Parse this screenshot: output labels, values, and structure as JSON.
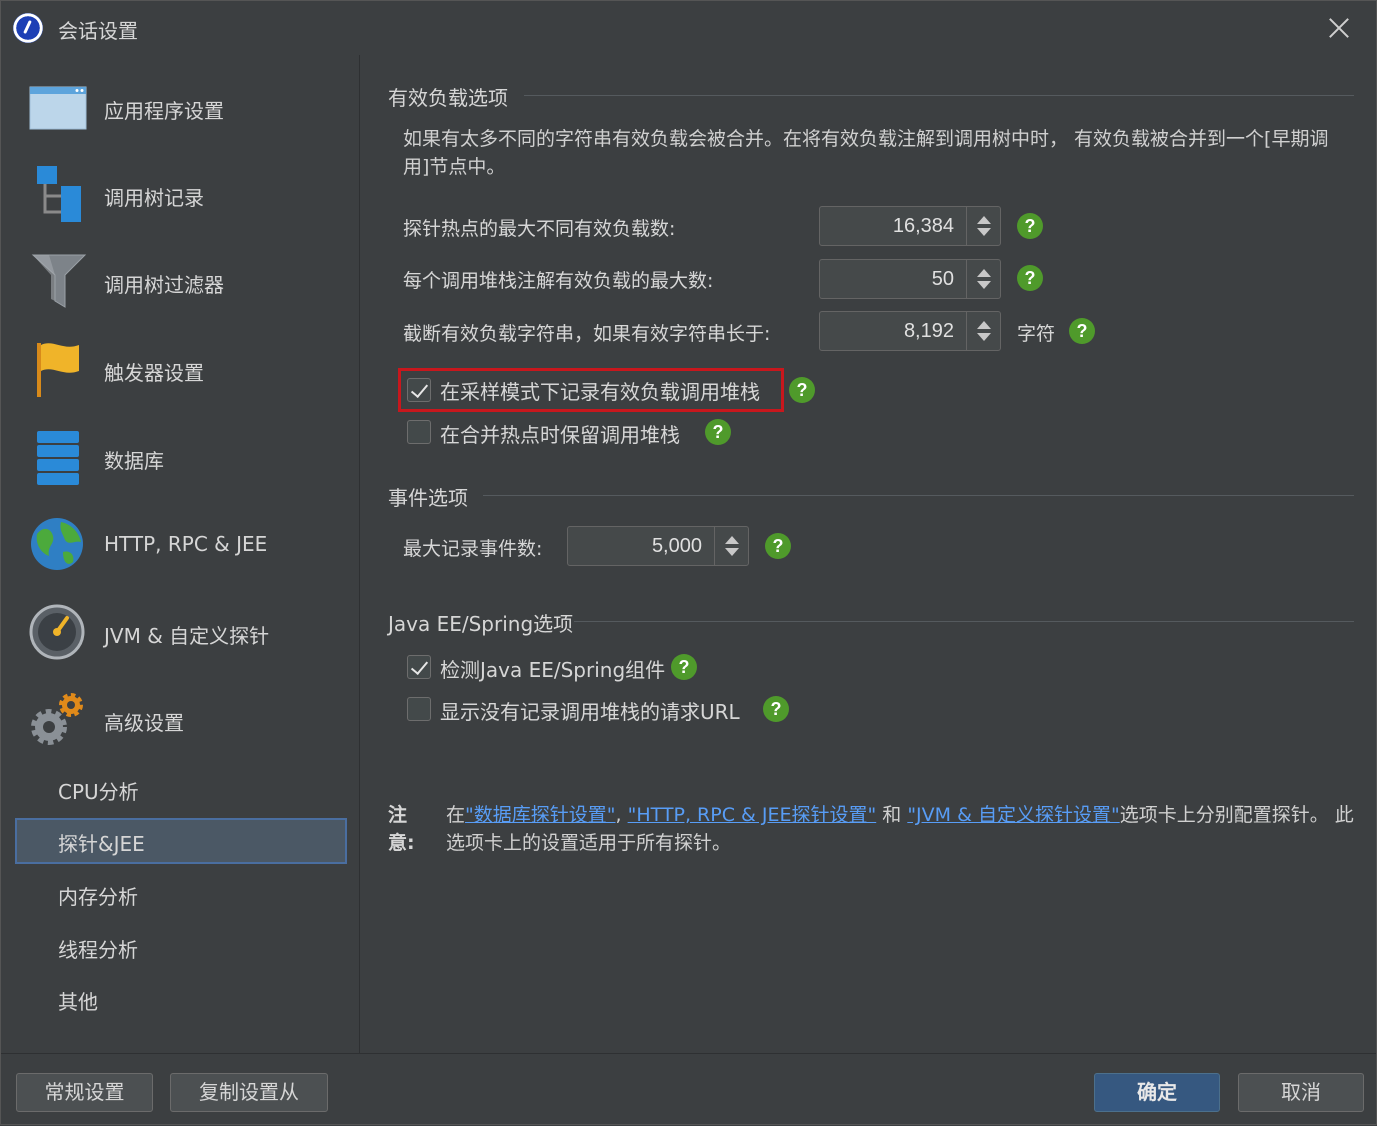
{
  "window": {
    "title": "会话设置"
  },
  "sidebar": {
    "items": [
      {
        "label": "应用程序设置"
      },
      {
        "label": "调用树记录"
      },
      {
        "label": "调用树过滤器"
      },
      {
        "label": "触发器设置"
      },
      {
        "label": "数据库"
      },
      {
        "label": "HTTP, RPC & JEE"
      },
      {
        "label": "JVM & 自定义探针"
      },
      {
        "label": "高级设置"
      }
    ],
    "subitems": [
      {
        "label": "CPU分析"
      },
      {
        "label": "探针&JEE"
      },
      {
        "label": "内存分析"
      },
      {
        "label": "线程分析"
      },
      {
        "label": "其他"
      }
    ],
    "selected_subitem": "探针&JEE"
  },
  "payload": {
    "title": "有效负载选项",
    "description": "如果有太多不同的字符串有效负载会被合并。在将有效负载注解到调用树中时， 有效负载被合并到一个[早期调用]节点中。",
    "max_distinct_label": "探针热点的最大不同有效负载数:",
    "max_distinct_value": "16,384",
    "max_per_stack_label": "每个调用堆栈注解有效负载的最大数:",
    "max_per_stack_value": "50",
    "truncate_label": "截断有效负载字符串，如果有效字符串长于:",
    "truncate_value": "8,192",
    "truncate_unit": "字符",
    "record_stacks_label": "在采样模式下记录有效负载调用堆栈",
    "record_stacks_checked": true,
    "retain_stacks_label": "在合并热点时保留调用堆栈",
    "retain_stacks_checked": false
  },
  "events": {
    "title": "事件选项",
    "max_events_label": "最大记录事件数:",
    "max_events_value": "5,000"
  },
  "javaee": {
    "title": "Java EE/Spring选项",
    "detect_label": "检测Java EE/Spring组件",
    "detect_checked": true,
    "show_urls_label": "显示没有记录调用堆栈的请求URL",
    "show_urls_checked": false
  },
  "note": {
    "head": "注意:",
    "prefix": "在",
    "link1": "\"数据库探针设置\"",
    "sep1": ", ",
    "link2": "\"HTTP, RPC & JEE探针设置\"",
    "sep2": " 和 ",
    "link3": "\"JVM & 自定义探针设置\"",
    "suffix": "选项卡上分别配置探针。 此选项卡上的设置适用于所有探针。"
  },
  "help_symbol": "?",
  "footer": {
    "general_settings": "常规设置",
    "copy_settings": "复制设置从",
    "ok": "确定",
    "cancel": "取消"
  },
  "colors": {
    "background": "#3c3f41",
    "help_green": "#4f9a2b",
    "highlight_red": "#c8171d",
    "link_blue": "#589df6",
    "primary_button": "#365880"
  }
}
